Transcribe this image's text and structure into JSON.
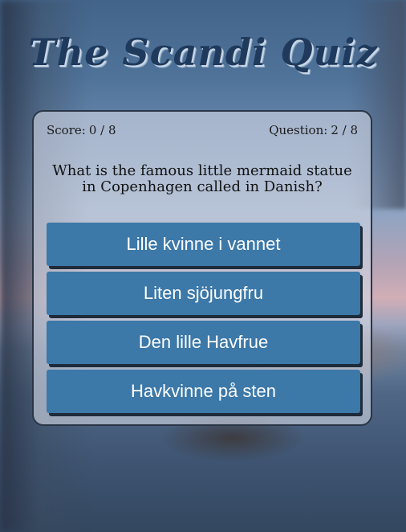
{
  "app": {
    "title": "The Scandi Quiz"
  },
  "stats": {
    "score_label": "Score:",
    "score_value": "0 / 8",
    "question_label": "Question:",
    "question_value": "2 / 8"
  },
  "question": {
    "text": "What is the famous little mermaid statue in Copenhagen called in Danish?"
  },
  "answers": [
    {
      "label": "Lille kvinne i vannet"
    },
    {
      "label": "Liten sjöjungfru"
    },
    {
      "label": "Den lille Havfrue"
    },
    {
      "label": "Havkvinne på sten"
    }
  ],
  "colors": {
    "button": "#3c78a8",
    "button_shadow": "#1e2b3a",
    "title": "#1f3a5c",
    "card_border": "#2a3546"
  }
}
